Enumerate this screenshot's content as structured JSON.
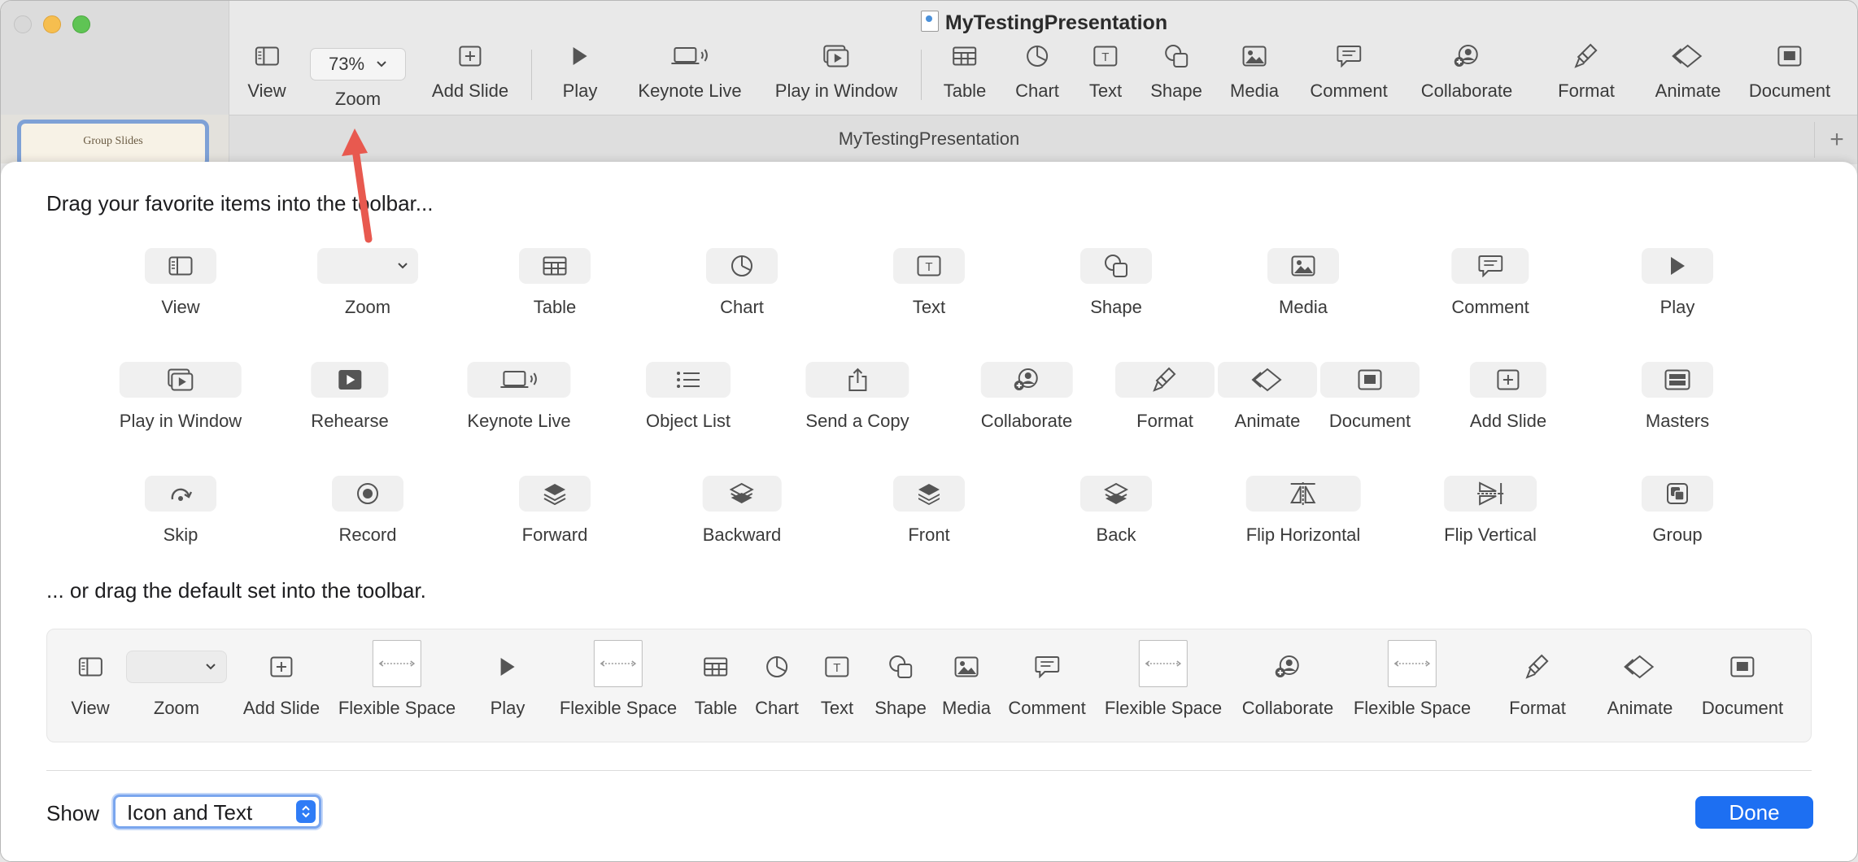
{
  "window": {
    "title": "MyTestingPresentation",
    "tab_title": "MyTestingPresentation",
    "tab_add": "+",
    "sidebar_thumb_label": "Group Slides"
  },
  "toolbar": {
    "zoom_value": "73%",
    "items": [
      {
        "label": "View",
        "icon": "sidebar-icon"
      },
      {
        "label": "Zoom",
        "icon": "zoom-dropdown"
      },
      {
        "label": "Add Slide",
        "icon": "plus-square-icon"
      },
      {
        "label": "Play",
        "icon": "play-icon"
      },
      {
        "label": "Keynote Live",
        "icon": "laptop-broadcast-icon"
      },
      {
        "label": "Play in Window",
        "icon": "play-window-icon"
      },
      {
        "label": "Table",
        "icon": "table-icon"
      },
      {
        "label": "Chart",
        "icon": "pie-chart-icon"
      },
      {
        "label": "Text",
        "icon": "text-box-icon"
      },
      {
        "label": "Shape",
        "icon": "shape-icon"
      },
      {
        "label": "Media",
        "icon": "photo-icon"
      },
      {
        "label": "Comment",
        "icon": "speech-bubble-icon"
      },
      {
        "label": "Collaborate",
        "icon": "collaborate-icon"
      },
      {
        "label": "Format",
        "icon": "paintbrush-icon"
      },
      {
        "label": "Animate",
        "icon": "diamond-icon"
      },
      {
        "label": "Document",
        "icon": "document-icon"
      }
    ]
  },
  "customize": {
    "heading": "Drag your favorite items into the toolbar...",
    "row1": [
      {
        "label": "View",
        "icon": "sidebar-icon"
      },
      {
        "label": "Zoom",
        "icon": "zoom-dropdown"
      },
      {
        "label": "Table",
        "icon": "table-icon"
      },
      {
        "label": "Chart",
        "icon": "pie-chart-icon"
      },
      {
        "label": "Text",
        "icon": "text-box-icon"
      },
      {
        "label": "Shape",
        "icon": "shape-icon"
      },
      {
        "label": "Media",
        "icon": "photo-icon"
      },
      {
        "label": "Comment",
        "icon": "speech-bubble-icon"
      },
      {
        "label": "Play",
        "icon": "play-icon"
      }
    ],
    "row2": [
      {
        "label": "Play in Window",
        "icon": "play-window-icon"
      },
      {
        "label": "Rehearse",
        "icon": "rehearse-icon"
      },
      {
        "label": "Keynote Live",
        "icon": "laptop-broadcast-icon"
      },
      {
        "label": "Object List",
        "icon": "list-icon"
      },
      {
        "label": "Send a Copy",
        "icon": "share-icon"
      },
      {
        "label": "Collaborate",
        "icon": "collaborate-icon"
      },
      {
        "label": "Format",
        "icon": "paintbrush-icon"
      },
      {
        "label": "Animate",
        "icon": "diamond-icon"
      },
      {
        "label": "Document",
        "icon": "document-icon"
      },
      {
        "label": "Add Slide",
        "icon": "plus-square-icon"
      },
      {
        "label": "Masters",
        "icon": "masters-icon"
      }
    ],
    "row3": [
      {
        "label": "Skip",
        "icon": "skip-icon"
      },
      {
        "label": "Record",
        "icon": "record-icon"
      },
      {
        "label": "Forward",
        "icon": "forward-layers-icon"
      },
      {
        "label": "Backward",
        "icon": "backward-layers-icon"
      },
      {
        "label": "Front",
        "icon": "front-layers-icon"
      },
      {
        "label": "Back",
        "icon": "back-layers-icon"
      },
      {
        "label": "Flip Horizontal",
        "icon": "flip-horizontal-icon"
      },
      {
        "label": "Flip Vertical",
        "icon": "flip-vertical-icon"
      },
      {
        "label": "Group",
        "icon": "group-icon"
      }
    ],
    "default_heading": "... or drag the default set into the toolbar.",
    "default_set": [
      {
        "label": "View",
        "icon": "sidebar-icon"
      },
      {
        "label": "Zoom",
        "icon": "zoom-dropdown"
      },
      {
        "label": "Add Slide",
        "icon": "plus-square-icon"
      },
      {
        "label": "Flexible Space",
        "icon": "flexible-space-icon"
      },
      {
        "label": "Play",
        "icon": "play-icon"
      },
      {
        "label": "Flexible Space",
        "icon": "flexible-space-icon"
      },
      {
        "label": "Table",
        "icon": "table-icon"
      },
      {
        "label": "Chart",
        "icon": "pie-chart-icon"
      },
      {
        "label": "Text",
        "icon": "text-box-icon"
      },
      {
        "label": "Shape",
        "icon": "shape-icon"
      },
      {
        "label": "Media",
        "icon": "photo-icon"
      },
      {
        "label": "Comment",
        "icon": "speech-bubble-icon"
      },
      {
        "label": "Flexible Space",
        "icon": "flexible-space-icon"
      },
      {
        "label": "Collaborate",
        "icon": "collaborate-icon"
      },
      {
        "label": "Flexible Space",
        "icon": "flexible-space-icon"
      },
      {
        "label": "Format",
        "icon": "paintbrush-icon"
      },
      {
        "label": "Animate",
        "icon": "diamond-icon"
      },
      {
        "label": "Document",
        "icon": "document-icon"
      }
    ],
    "show_label": "Show",
    "show_value": "Icon and Text",
    "done_label": "Done"
  },
  "colors": {
    "accent": "#1d6ff2",
    "annotation_arrow": "#e8594f",
    "traffic_yellow": "#f6be4f",
    "traffic_green": "#5fc454"
  }
}
